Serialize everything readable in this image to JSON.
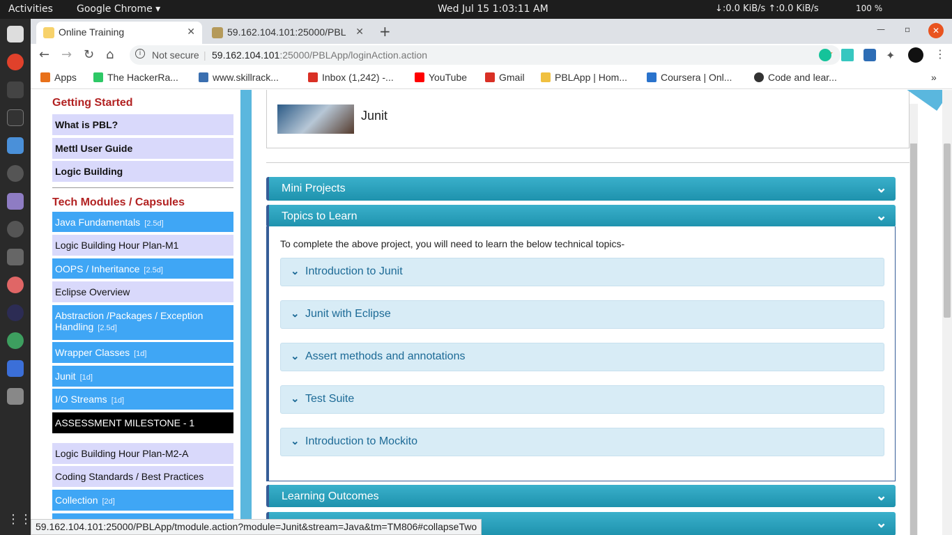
{
  "topbar": {
    "activities": "Activities",
    "app": "Google Chrome ▾",
    "clock": "Wed Jul 15   1:03:11 AM",
    "net": "↓:0.0 KiB/s  ↑:0.0 KiB/s",
    "battery": "100 %"
  },
  "tabs": [
    {
      "title": "Online Training"
    },
    {
      "title": "59.162.104.101:25000/PBL"
    }
  ],
  "omnibox": {
    "security": "Not secure",
    "host": "59.162.104.101",
    "path": ":25000/PBLApp/loginAction.action"
  },
  "bookmarks": [
    {
      "label": "Apps",
      "icon": "apps-grid-icon",
      "color": "#e8711a"
    },
    {
      "label": "The HackerRa...",
      "icon": "hackerrank-icon",
      "color": "#2ec866"
    },
    {
      "label": "www.skillrack...",
      "icon": "skillrack-icon",
      "color": "#3a6fb0"
    },
    {
      "label": "Inbox (1,242) -...",
      "icon": "gmail-icon",
      "color": "#d93025"
    },
    {
      "label": "YouTube",
      "icon": "youtube-icon",
      "color": "#ff0000"
    },
    {
      "label": "Gmail",
      "icon": "gmail-icon",
      "color": "#d93025"
    },
    {
      "label": "PBLApp | Hom...",
      "icon": "pbl-icon",
      "color": "#f0c040"
    },
    {
      "label": "Coursera | Onl...",
      "icon": "coursera-icon",
      "color": "#2a73cc"
    },
    {
      "label": "Code and lear...",
      "icon": "code-icon",
      "color": "#333333"
    }
  ],
  "sidebar": {
    "getting_started": "Getting Started",
    "gs_items": [
      "What is PBL?",
      "Mettl User Guide",
      "Logic Building"
    ],
    "tech_title": "Tech Modules / Capsules",
    "items": [
      {
        "label": "Java Fundamentals",
        "dur": "[2.5d]",
        "style": "blue"
      },
      {
        "label": "Logic Building Hour Plan-M1",
        "dur": "",
        "style": "lav"
      },
      {
        "label": "OOPS / Inheritance",
        "dur": "[2.5d]",
        "style": "blue"
      },
      {
        "label": "Eclipse Overview",
        "dur": "",
        "style": "lav"
      },
      {
        "label": "Abstraction /Packages / Exception Handling",
        "dur": "[2.5d]",
        "style": "blue"
      },
      {
        "label": "Wrapper Classes",
        "dur": "[1d]",
        "style": "blue"
      },
      {
        "label": "Junit",
        "dur": "[1d]",
        "style": "blue"
      },
      {
        "label": "I/O Streams",
        "dur": "[1d]",
        "style": "blue"
      },
      {
        "label": "ASSESSMENT MILESTONE - 1",
        "dur": "",
        "style": "black"
      },
      {
        "label": "Logic Building Hour Plan-M2-A",
        "dur": "",
        "style": "lav"
      },
      {
        "label": "Coding Standards / Best Practices",
        "dur": "",
        "style": "lav"
      },
      {
        "label": "Collection",
        "dur": "[2d]",
        "style": "blue"
      }
    ]
  },
  "main": {
    "course_name": "Junit",
    "mini_projects": "Mini Projects",
    "topics_to_learn": "Topics to Learn",
    "intro": "To complete the above project, you will need to learn the below technical topics-",
    "topics": [
      "Introduction to Junit",
      "Junit with Eclipse",
      "Assert methods and annotations",
      "Test Suite",
      "Introduction to Mockito"
    ],
    "learning_outcomes": "Learning Outcomes"
  },
  "status_url": "59.162.104.101:25000/PBLApp/tmodule.action?module=Junit&stream=Java&tm=TM806#collapseTwo"
}
